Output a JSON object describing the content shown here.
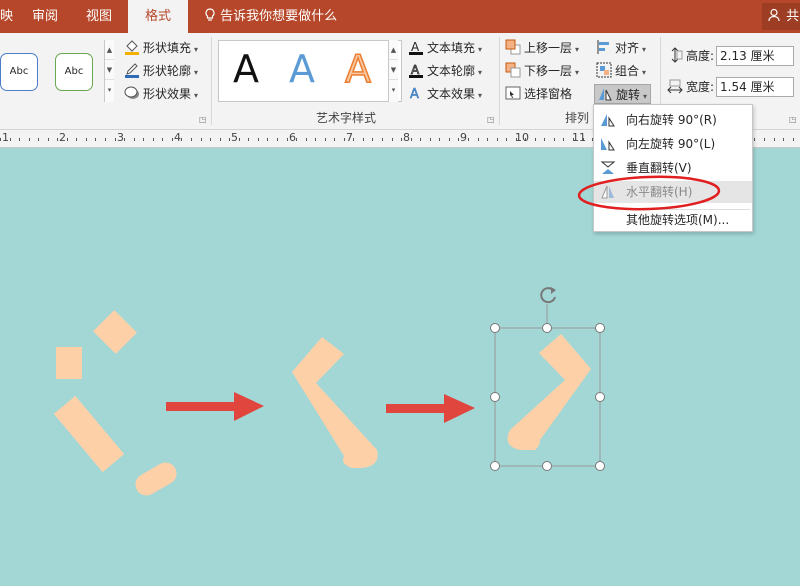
{
  "tabs": {
    "partial": "映",
    "review": "审阅",
    "view": "视图",
    "format": "格式",
    "tell_me": "告诉我你想要做什么",
    "share": "共"
  },
  "shape_styles": {
    "style1": "Abc",
    "style2": "Abc",
    "fill": "形状填充",
    "outline": "形状轮廓",
    "effects": "形状效果"
  },
  "wordart": {
    "sample1": "A",
    "sample2": "A",
    "sample3": "A",
    "text_fill": "文本填充",
    "text_outline": "文本轮廓",
    "text_effects": "文本效果",
    "group_label": "艺术字样式"
  },
  "arrange": {
    "bring_forward": "上移一层",
    "send_backward": "下移一层",
    "selection_pane": "选择窗格",
    "align": "对齐",
    "group": "组合",
    "rotate": "旋转",
    "group_label": "排列"
  },
  "size": {
    "height_label": "高度:",
    "height_value": "2.13 厘米",
    "width_label": "宽度:",
    "width_value": "1.54 厘米"
  },
  "ruler": {
    "numbers": [
      "1",
      "2",
      "3",
      "4",
      "5",
      "6",
      "7",
      "8",
      "9",
      "10",
      "11"
    ]
  },
  "rotate_menu": {
    "items": [
      "向右旋转 90°(R)",
      "向左旋转 90°(L)",
      "垂直翻转(V)",
      "水平翻转(H)",
      "其他旋转选项(M)..."
    ]
  },
  "colors": {
    "accent": "#b7472a",
    "canvas": "#a3d7d6",
    "shape": "#fdd0a8",
    "arrow": "#e0453e",
    "annotation": "#e02020"
  }
}
